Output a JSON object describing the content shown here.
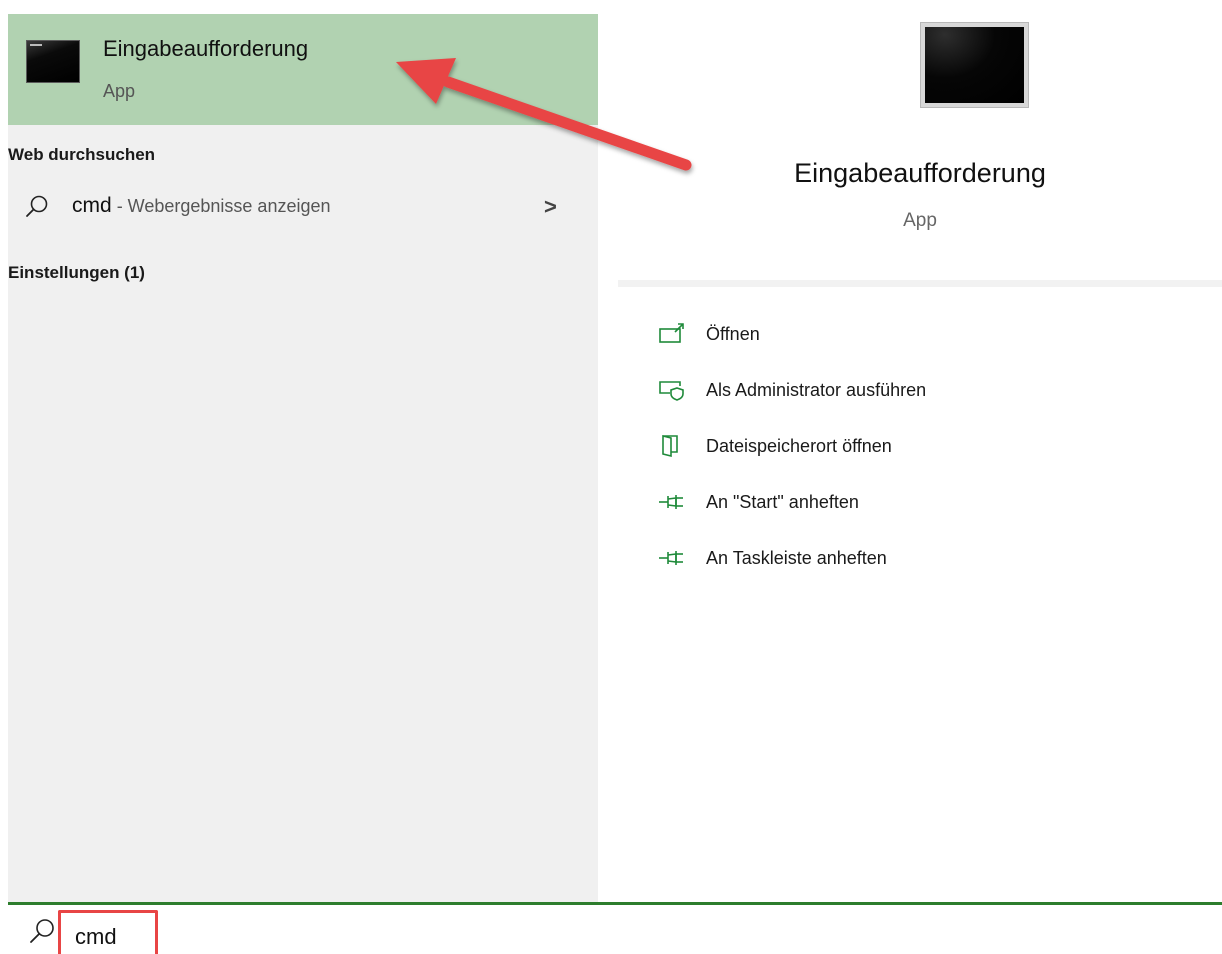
{
  "best_match": {
    "title": "Eingabeaufforderung",
    "subtitle": "App"
  },
  "web_section": {
    "header": "Web durchsuchen",
    "query": "cmd",
    "suffix": " - Webergebnisse anzeigen"
  },
  "settings_section": {
    "header": "Einstellungen (1)"
  },
  "preview": {
    "title": "Eingabeaufforderung",
    "subtitle": "App"
  },
  "actions": [
    {
      "label": "Öffnen",
      "icon": "open-window-icon"
    },
    {
      "label": "Als Administrator ausführen",
      "icon": "shield-run-icon"
    },
    {
      "label": "Dateispeicherort öffnen",
      "icon": "file-location-icon"
    },
    {
      "label": "An \"Start\" anheften",
      "icon": "pin-icon"
    },
    {
      "label": "An Taskleiste anheften",
      "icon": "pin-icon"
    }
  ],
  "search": {
    "value": "cmd"
  },
  "colors": {
    "accent": "#2d7d2d",
    "selection": "#b1d2b1",
    "annotation_red": "#e84545",
    "icon_green": "#1f8a3a"
  }
}
